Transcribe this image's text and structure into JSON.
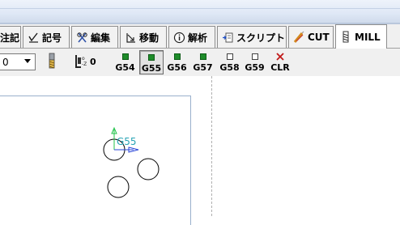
{
  "tabs": [
    {
      "id": "annotation",
      "label": "注記",
      "icon": "annotation-icon",
      "active": false
    },
    {
      "id": "symbol",
      "label": "記号",
      "icon": "check-symbol-icon",
      "active": false
    },
    {
      "id": "edit",
      "label": "編集",
      "icon": "edit-icon",
      "active": false
    },
    {
      "id": "move",
      "label": "移動",
      "icon": "move-icon",
      "active": false
    },
    {
      "id": "analysis",
      "label": "解析",
      "icon": "info-icon",
      "active": false
    },
    {
      "id": "script",
      "label": "スクリプト",
      "icon": "script-icon",
      "active": false
    },
    {
      "id": "cut",
      "label": "CUT",
      "icon": "cut-icon",
      "active": false
    },
    {
      "id": "mill",
      "label": "MILL",
      "icon": "mill-icon",
      "active": true
    }
  ],
  "toolbar": {
    "dropdown_value": "0",
    "z_label": "0",
    "work_offsets": [
      {
        "label": "G54",
        "state": "on",
        "pressed": false
      },
      {
        "label": "G55",
        "state": "on",
        "pressed": true
      },
      {
        "label": "G56",
        "state": "on",
        "pressed": false
      },
      {
        "label": "G57",
        "state": "on",
        "pressed": false
      },
      {
        "label": "G58",
        "state": "off",
        "pressed": false
      },
      {
        "label": "G59",
        "state": "off",
        "pressed": false
      }
    ],
    "clear_label": "CLR"
  },
  "canvas": {
    "origin_label": "G55",
    "colors": {
      "axis_y": "#22c34a",
      "axis_x": "#2a45d8",
      "origin_text": "#27a3b4",
      "circle": "#000000"
    }
  }
}
